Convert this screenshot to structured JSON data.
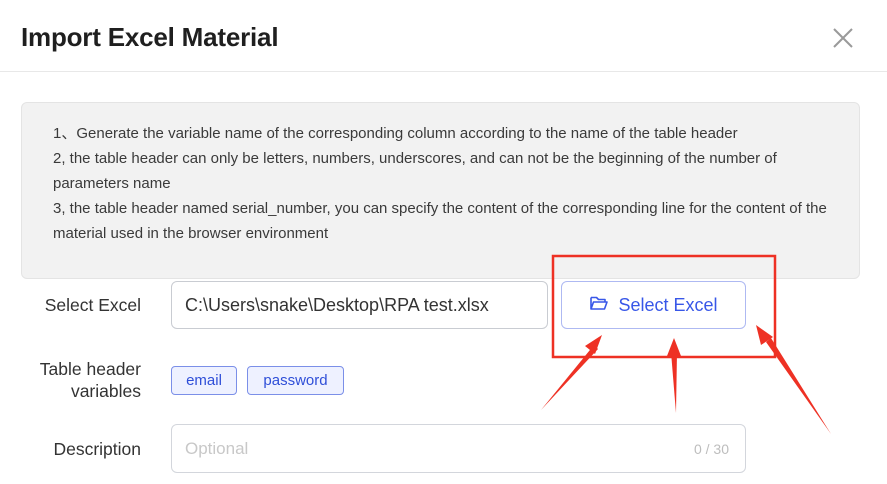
{
  "dialog": {
    "title": "Import Excel Material",
    "close_icon": "close-icon"
  },
  "notice": {
    "lines": [
      "1、Generate the variable name of the corresponding column according to the name of the table header",
      "2, the table header can only be letters, numbers, underscores, and can not be the beginning of the number of parameters name",
      "3, the table header named serial_number, you can specify the content of the corresponding line for the content of the material used in the browser environment"
    ]
  },
  "form": {
    "select_excel": {
      "label": "Select Excel",
      "value": "C:\\Users\\snake\\Desktop\\RPA test.xlsx",
      "button_label": "Select Excel",
      "button_icon": "folder-open-icon"
    },
    "header_variables": {
      "label": "Table header variables",
      "tags": [
        "email",
        "password"
      ]
    },
    "description": {
      "label": "Description",
      "placeholder": "Optional",
      "value": "",
      "counter": "0 / 30"
    }
  },
  "colors": {
    "accent": "#3857e8",
    "annotation": "#ee3124"
  }
}
